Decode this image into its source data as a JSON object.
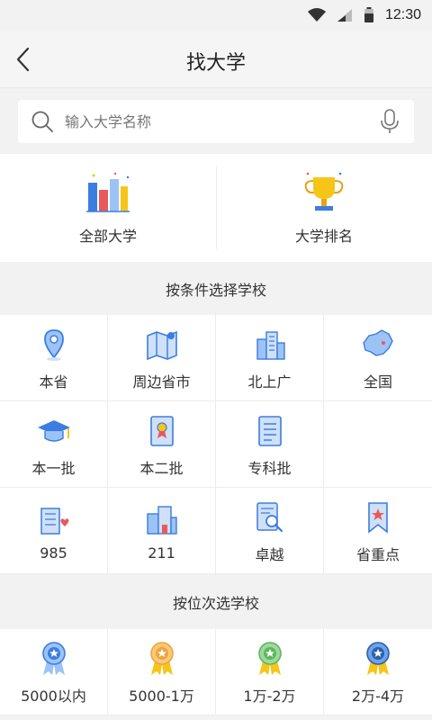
{
  "status_bar": {
    "time": "12:30",
    "icons": [
      "wifi-icon",
      "signal-icon",
      "battery-icon"
    ]
  },
  "header": {
    "back_icon": "chevron-left-icon",
    "title": "找大学"
  },
  "search": {
    "placeholder": "输入大学名称",
    "value": "",
    "left_icon": "search-icon",
    "right_icon": "microphone-icon"
  },
  "top_cards": [
    {
      "label": "全部大学",
      "icon": "bar-chart-icon"
    },
    {
      "label": "大学排名",
      "icon": "trophy-icon"
    }
  ],
  "condition_section": {
    "title": "按条件选择学校",
    "items": [
      {
        "label": "本省",
        "icon": "location-pin-icon"
      },
      {
        "label": "周边省市",
        "icon": "map-icon"
      },
      {
        "label": "北上广",
        "icon": "buildings-icon"
      },
      {
        "label": "全国",
        "icon": "china-map-icon"
      },
      {
        "label": "本一批",
        "icon": "graduation-cap-icon"
      },
      {
        "label": "本二批",
        "icon": "certificate-icon"
      },
      {
        "label": "专科批",
        "icon": "document-list-icon"
      },
      {
        "label": "",
        "icon": ""
      },
      {
        "label": "985",
        "icon": "building-heart-icon"
      },
      {
        "label": "211",
        "icon": "school-building-icon"
      },
      {
        "label": "卓越",
        "icon": "document-search-icon"
      },
      {
        "label": "省重点",
        "icon": "bookmark-star-icon"
      }
    ]
  },
  "rank_section": {
    "title": "按位次选学校",
    "items": [
      {
        "label": "5000以内",
        "icon": "medal-blue-icon"
      },
      {
        "label": "5000-1万",
        "icon": "medal-orange-icon"
      },
      {
        "label": "1万-2万",
        "icon": "medal-green-icon"
      },
      {
        "label": "2万-4万",
        "icon": "medal-navy-icon"
      }
    ]
  },
  "colors": {
    "icon_blue": "#3b7de0",
    "icon_light_blue": "#9cc3f5",
    "accent_yellow": "#f5c518",
    "accent_red": "#e85a5a",
    "medal_orange": "#f0a43c",
    "medal_green": "#5cb85c"
  }
}
